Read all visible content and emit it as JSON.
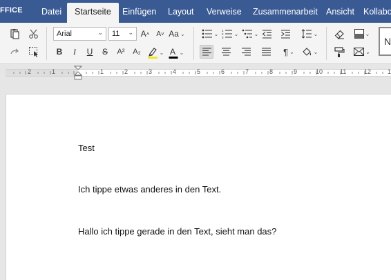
{
  "app": {
    "brand": "FFICE"
  },
  "tabs": [
    {
      "label": "Datei"
    },
    {
      "label": "Startseite"
    },
    {
      "label": "Einfügen"
    },
    {
      "label": "Layout"
    },
    {
      "label": "Verweise"
    },
    {
      "label": "Zusammenarbeit"
    },
    {
      "label": "Ansicht"
    },
    {
      "label": "Kollabor"
    }
  ],
  "toolbar": {
    "font_name": "Arial",
    "font_size": "11",
    "bold_label": "B",
    "italic_label": "I",
    "underline_label": "U",
    "strike_label": "S",
    "superscript_label": "A²",
    "subscript_label": "A₂",
    "grow_label": "A",
    "shrink_label": "A",
    "case_label": "Aa",
    "pilcrow_label": "¶",
    "style_preview": "N",
    "highlight_color": "#f2e600",
    "font_color": "#000000",
    "brand_color": "#3a5a94"
  },
  "ruler": {
    "labels": [
      "2",
      "1",
      "1",
      "2",
      "3",
      "4",
      "5",
      "6",
      "7",
      "8",
      "9",
      "10",
      "11",
      "12",
      "1"
    ]
  },
  "document": {
    "paragraphs": [
      "Test",
      "Ich tippe etwas anderes in den Text.",
      "Hallo ich tippe gerade in den Text, sieht man das?"
    ]
  }
}
